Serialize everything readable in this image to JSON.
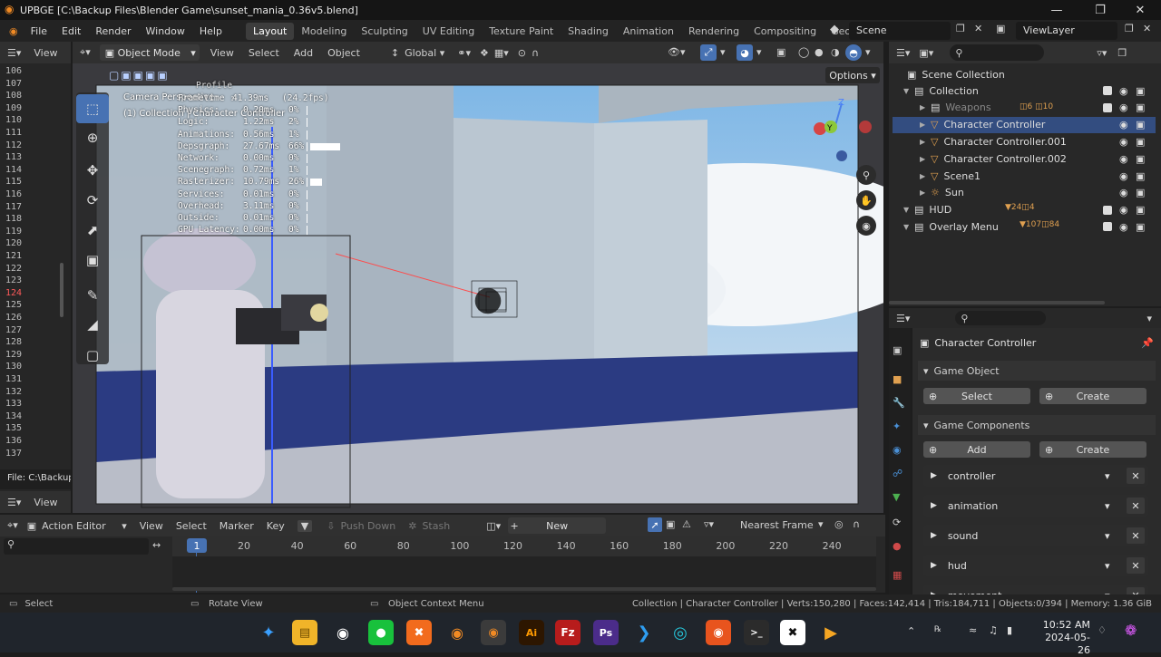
{
  "window": {
    "title": "UPBGE [C:\\Backup Files\\Blender Game\\sunset_mania_0.36v5.blend]"
  },
  "menu": [
    "File",
    "Edit",
    "Render",
    "Window",
    "Help"
  ],
  "workspaces": [
    "Layout",
    "Modeling",
    "Sculpting",
    "UV Editing",
    "Texture Paint",
    "Shading",
    "Animation",
    "Rendering",
    "Compositing",
    "Geometry Noc"
  ],
  "scene": {
    "name": "Scene",
    "view_layer": "ViewLayer"
  },
  "text_editor": {
    "view_label": "View",
    "line_numbers": [
      "106",
      "107",
      "108",
      "109",
      "110",
      "111",
      "112",
      "113",
      "114",
      "115",
      "116",
      "117",
      "118",
      "119",
      "120",
      "121",
      "122",
      "123",
      "124",
      "125",
      "126",
      "127",
      "128",
      "129",
      "130",
      "131",
      "132",
      "133",
      "134",
      "135",
      "136",
      "137"
    ],
    "highlight_line": "124",
    "file_label": "File: C:\\Backup"
  },
  "viewport": {
    "mode": "Object Mode",
    "menus": [
      "View",
      "Select",
      "Add",
      "Object"
    ],
    "transform": "Global",
    "options": "Options",
    "camera_label": "Camera Perspective",
    "collection_label": "(1) Collection | Character Controller",
    "profile": "Profile",
    "stats": [
      {
        "label": "Frametime :",
        "value": "41.39ms",
        "pct": "(24.2fps)",
        "bar": 0
      },
      {
        "label": "Physics:",
        "value": "0.20ms",
        "pct": "0%",
        "bar": 0
      },
      {
        "label": "Logic:",
        "value": "1.22ms",
        "pct": "2%",
        "bar": 0
      },
      {
        "label": "Animations:",
        "value": "0.56ms",
        "pct": "1%",
        "bar": 0
      },
      {
        "label": "Depsgraph:",
        "value": "27.67ms",
        "pct": "66%",
        "bar": 0.66
      },
      {
        "label": "Network:",
        "value": "0.00ms",
        "pct": "0%",
        "bar": 0
      },
      {
        "label": "Scenegraph:",
        "value": "0.72ms",
        "pct": "1%",
        "bar": 0
      },
      {
        "label": "Rasterizer:",
        "value": "10.79ms",
        "pct": "26%",
        "bar": 0.26
      },
      {
        "label": "Services:",
        "value": "0.01ms",
        "pct": "0%",
        "bar": 0
      },
      {
        "label": "Overhead:",
        "value": "3.11ms",
        "pct": "0%",
        "bar": 0
      },
      {
        "label": "Outside:",
        "value": "0.01ms",
        "pct": "0%",
        "bar": 0
      },
      {
        "label": "GPU Latency:",
        "value": "0.00ms",
        "pct": "0%",
        "bar": 0
      }
    ]
  },
  "outliner": {
    "root": "Scene Collection",
    "items": [
      {
        "name": "Collection",
        "indent": 0,
        "type": "collection"
      },
      {
        "name": "Weapons",
        "indent": 1,
        "type": "collection",
        "dim": true
      },
      {
        "name": "Character Controller",
        "indent": 1,
        "type": "object"
      },
      {
        "name": "Character Controller.001",
        "indent": 1,
        "type": "object"
      },
      {
        "name": "Character Controller.002",
        "indent": 1,
        "type": "object"
      },
      {
        "name": "Scene1",
        "indent": 1,
        "type": "object"
      },
      {
        "name": "Sun",
        "indent": 1,
        "type": "light"
      },
      {
        "name": "HUD",
        "indent": 0,
        "type": "collection"
      },
      {
        "name": "Overlay Menu",
        "indent": 0,
        "type": "collection"
      }
    ],
    "badges": {
      "weapons_a": "6",
      "weapons_b": "10",
      "hud_a": "24",
      "hud_b": "4",
      "overlay_a": "107",
      "overlay_b": "84"
    }
  },
  "properties": {
    "object_name": "Character Controller",
    "game_object": "Game Object",
    "select": "Select",
    "create": "Create",
    "game_components": "Game Components",
    "add": "Add",
    "components": [
      "controller",
      "animation",
      "sound",
      "hud",
      "movement"
    ]
  },
  "action_editor": {
    "view": "View",
    "mode": "Action Editor",
    "menus": [
      "View",
      "Select",
      "Marker",
      "Key"
    ],
    "push_down": "Push Down",
    "stash": "Stash",
    "new": "New",
    "snap": "Nearest Frame",
    "current_frame": "1",
    "ticks": [
      "20",
      "40",
      "60",
      "80",
      "100",
      "120",
      "140",
      "160",
      "180",
      "200",
      "220",
      "240"
    ]
  },
  "status": {
    "select": "Select",
    "rotate": "Rotate View",
    "context": "Object Context Menu",
    "info": "Collection | Character Controller | Verts:150,280 | Faces:142,414 | Tris:184,711 | Objects:0/394 | Memory: 1.36 GiB"
  },
  "taskbar": {
    "time": "10:52 AM",
    "date": "2024-05-26"
  },
  "colors": {
    "accent": "#4772b3",
    "active_ws": "#3d3d3d",
    "bg": "#1d1d1d"
  }
}
